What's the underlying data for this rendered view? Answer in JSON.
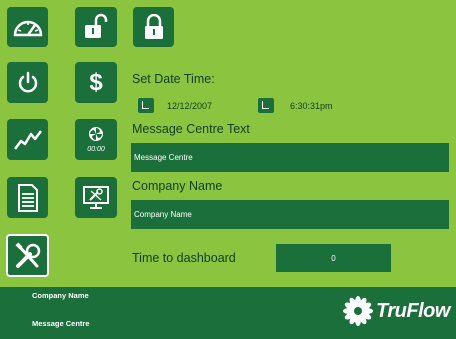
{
  "nav": {
    "dashboard_icon": "gauge-icon",
    "power_icon": "power-icon",
    "graph_icon": "line-graph-icon",
    "report_icon": "document-icon",
    "tools_icon": "tools-icon",
    "unlock_icon": "unlock-icon",
    "dollar_icon": "dollar-icon",
    "dollar_label": "$",
    "fan_icon": "fan-icon",
    "timer_label": "00:00",
    "monitor_icon": "monitor-settings-icon",
    "lock_icon": "lock-icon"
  },
  "form": {
    "set_date_time_label": "Set Date Time:",
    "date_value": "12/12/2007",
    "time_value": "6:30:31pm",
    "message_centre_label": "Message Centre Text",
    "message_centre_value": "Message Centre",
    "company_name_label": "Company Name",
    "company_name_value": "Company Name",
    "time_to_dashboard_label": "Time to dashboard",
    "time_to_dashboard_value": "0"
  },
  "footer": {
    "company_name": "Company Name",
    "message_centre": "Message Centre",
    "brand": "TruFlow"
  },
  "colors": {
    "background": "#8bc43f",
    "button": "#1a6f3a",
    "text": "#0f3f22"
  }
}
